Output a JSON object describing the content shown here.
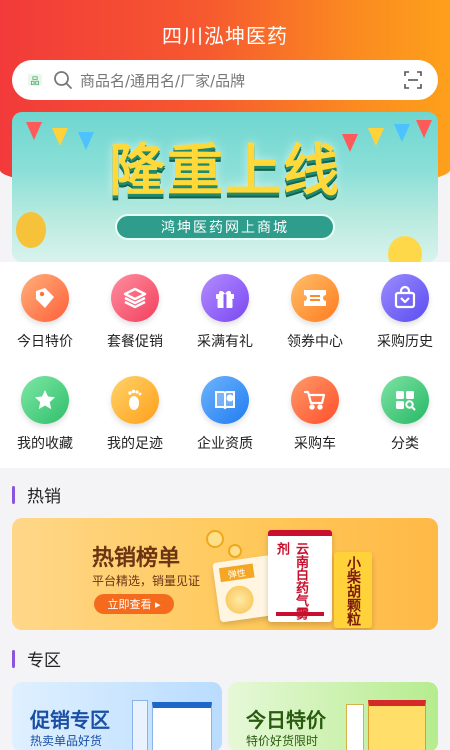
{
  "header": {
    "title": "四川泓坤医药"
  },
  "search": {
    "placeholder": "商品名/通用名/厂家/品牌"
  },
  "banner": {
    "title": "隆重上线",
    "subtitle": "鸿坤医药网上商城"
  },
  "grid": [
    {
      "label": "今日特价",
      "icon": "price-tag-icon",
      "color": "#ff7a45"
    },
    {
      "label": "套餐促销",
      "icon": "layers-icon",
      "color": "#ff5a6e"
    },
    {
      "label": "采满有礼",
      "icon": "gift-icon",
      "color": "#8d5cf6"
    },
    {
      "label": "领券中心",
      "icon": "coupon-icon",
      "color": "#ff8a2a"
    },
    {
      "label": "采购历史",
      "icon": "shopping-bag-icon",
      "color": "#6b63f6"
    },
    {
      "label": "我的收藏",
      "icon": "star-icon",
      "color": "#3fcf7a"
    },
    {
      "label": "我的足迹",
      "icon": "footprint-icon",
      "color": "#ffb62e"
    },
    {
      "label": "企业资质",
      "icon": "certificate-book-icon",
      "color": "#2f8cf5"
    },
    {
      "label": "采购车",
      "icon": "cart-icon",
      "color": "#ff6f3c"
    },
    {
      "label": "分类",
      "icon": "category-icon",
      "color": "#3ec77a"
    }
  ],
  "hot": {
    "title": "热销",
    "card_title": "热销榜单",
    "card_sub": "平台精选，销量见证",
    "button": "立即查看 ▸",
    "box1": "云南白药气雾剂",
    "box2": "小柴胡颗粒",
    "box3": "弹性"
  },
  "zone": {
    "title": "专区",
    "card1_title": "促销专区",
    "card1_sub": "热卖单品好货",
    "card2_title": "今日特价",
    "card2_sub": "特价好货限时"
  }
}
